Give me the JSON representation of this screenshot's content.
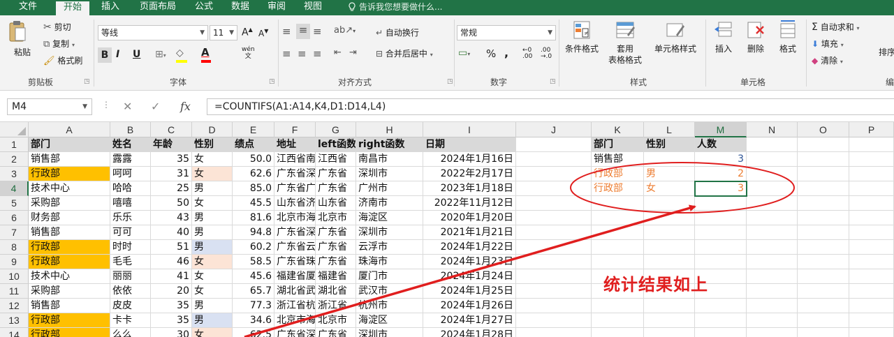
{
  "tabs": [
    "文件",
    "开始",
    "插入",
    "页面布局",
    "公式",
    "数据",
    "审阅",
    "视图"
  ],
  "active_tab": "开始",
  "tellme": "告诉我您想要做什么...",
  "ribbon": {
    "clipboard": {
      "paste": "粘贴",
      "cut": "剪切",
      "copy": "复制",
      "format_painter": "格式刷",
      "label": "剪贴板"
    },
    "font": {
      "name": "等线",
      "size": "11",
      "grow": "A",
      "shrink": "A",
      "bold": "B",
      "italic": "I",
      "underline": "U",
      "fontcolor": "A",
      "phonetic": "wén",
      "label": "字体"
    },
    "alignment": {
      "wrap": "自动换行",
      "merge": "合并后居中",
      "label": "对齐方式"
    },
    "number": {
      "format": "常规",
      "percent": "%",
      "comma": ",",
      "inc_dec": ".00",
      "label": "数字"
    },
    "styles": {
      "conditional": "条件格式",
      "table": "套用",
      "table2": "表格格式",
      "cell_styles": "单元格样式",
      "label": "样式"
    },
    "cells": {
      "insert": "插入",
      "delete": "删除",
      "format": "格式",
      "label": "单元格"
    },
    "editing": {
      "autosum": "自动求和",
      "fill": "填充",
      "clear": "清除",
      "sort": "排序",
      "label": "编"
    }
  },
  "formula_bar": {
    "namebox": "M4",
    "formula": "=COUNTIFS(A1:A14,K4,D1:D14,L4)"
  },
  "columns": [
    "A",
    "B",
    "C",
    "D",
    "E",
    "F",
    "G",
    "H",
    "I",
    "J",
    "K",
    "L",
    "M",
    "N",
    "O",
    "P"
  ],
  "selected_column": "M",
  "selected_row": "4",
  "rows": [
    {
      "n": "1",
      "dept": "部门",
      "name": "姓名",
      "age": "年龄",
      "gender": "性别",
      "score": "绩点",
      "addr": "地址",
      "left": "left函数",
      "right": "right函数",
      "date": "日期"
    },
    {
      "n": "2",
      "dept": "销售部",
      "name": "露露",
      "age": "35",
      "gender": "女",
      "score": "50.0",
      "addr": "江西省南",
      "left": "江西省",
      "right": "南昌市",
      "date": "2024年1月16日"
    },
    {
      "n": "3",
      "dept": "行政部",
      "name": "呵呵",
      "age": "31",
      "gender": "女",
      "score": "62.6",
      "addr": "广东省深",
      "left": "广东省",
      "right": "深圳市",
      "date": "2022年2月17日"
    },
    {
      "n": "4",
      "dept": "技术中心",
      "name": "哈哈",
      "age": "25",
      "gender": "男",
      "score": "85.0",
      "addr": "广东省广",
      "left": "广东省",
      "right": "广州市",
      "date": "2023年1月18日"
    },
    {
      "n": "5",
      "dept": "采购部",
      "name": "嘻嘻",
      "age": "50",
      "gender": "女",
      "score": "45.5",
      "addr": "山东省济",
      "left": "山东省",
      "right": "济南市",
      "date": "2022年11月12日"
    },
    {
      "n": "6",
      "dept": "财务部",
      "name": "乐乐",
      "age": "43",
      "gender": "男",
      "score": "81.6",
      "addr": "北京市海",
      "left": "北京市",
      "right": "海淀区",
      "date": "2020年1月20日"
    },
    {
      "n": "7",
      "dept": "销售部",
      "name": "可可",
      "age": "40",
      "gender": "男",
      "score": "94.8",
      "addr": "广东省深",
      "left": "广东省",
      "right": "深圳市",
      "date": "2021年1月21日"
    },
    {
      "n": "8",
      "dept": "行政部",
      "name": "时时",
      "age": "51",
      "gender": "男",
      "score": "60.2",
      "addr": "广东省云",
      "left": "广东省",
      "right": "云浮市",
      "date": "2024年1月22日"
    },
    {
      "n": "9",
      "dept": "行政部",
      "name": "毛毛",
      "age": "46",
      "gender": "女",
      "score": "58.5",
      "addr": "广东省珠",
      "left": "广东省",
      "right": "珠海市",
      "date": "2024年1月23日"
    },
    {
      "n": "10",
      "dept": "技术中心",
      "name": "丽丽",
      "age": "41",
      "gender": "女",
      "score": "45.6",
      "addr": "福建省厦",
      "left": "福建省",
      "right": "厦门市",
      "date": "2024年1月24日"
    },
    {
      "n": "11",
      "dept": "采购部",
      "name": "依依",
      "age": "20",
      "gender": "女",
      "score": "65.7",
      "addr": "湖北省武",
      "left": "湖北省",
      "right": "武汉市",
      "date": "2024年1月25日"
    },
    {
      "n": "12",
      "dept": "销售部",
      "name": "皮皮",
      "age": "35",
      "gender": "男",
      "score": "77.3",
      "addr": "浙江省杭",
      "left": "浙江省",
      "right": "杭州市",
      "date": "2024年1月26日"
    },
    {
      "n": "13",
      "dept": "行政部",
      "name": "卡卡",
      "age": "35",
      "gender": "男",
      "score": "34.6",
      "addr": "北京市海",
      "left": "北京市",
      "right": "海淀区",
      "date": "2024年1月27日"
    },
    {
      "n": "14",
      "dept": "行政部",
      "name": "么么",
      "age": "30",
      "gender": "女",
      "score": "62.5",
      "addr": "广东省深",
      "left": "广东省",
      "right": "深圳市",
      "date": "2024年1月28日"
    }
  ],
  "summary": [
    {
      "row": "1",
      "dept": "部门",
      "gender": "性别",
      "count": "人数"
    },
    {
      "row": "2",
      "dept": "销售部",
      "gender": "",
      "count": "3"
    },
    {
      "row": "3",
      "dept": "行政部",
      "gender": "男",
      "count": "2"
    },
    {
      "row": "4",
      "dept": "行政部",
      "gender": "女",
      "count": "3"
    }
  ],
  "annotation": "统计结果如上",
  "colors": {
    "excel_green": "#217346",
    "highlight_orange": "#ffc000",
    "annotation_red": "#e01e1e"
  }
}
